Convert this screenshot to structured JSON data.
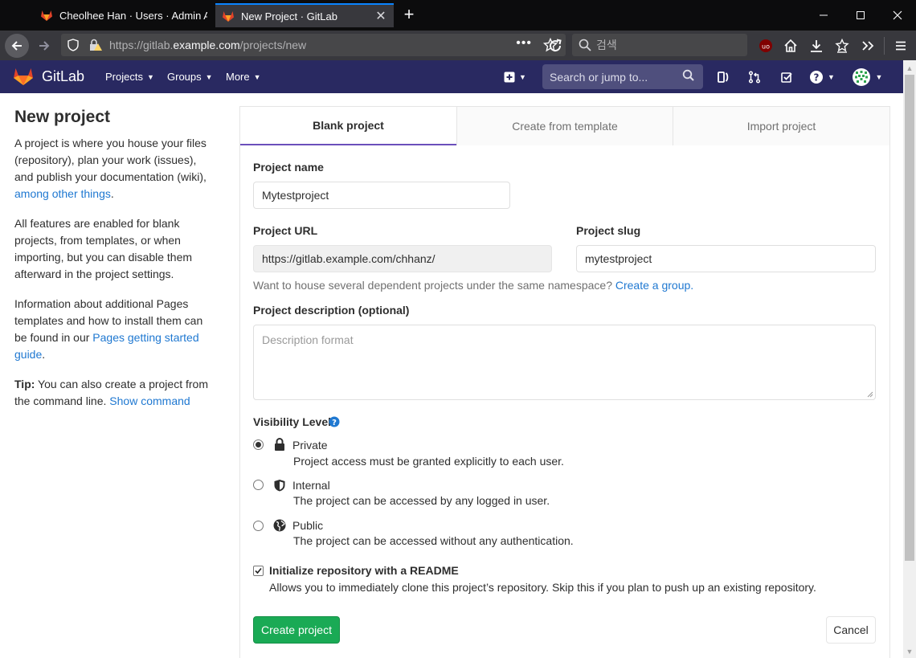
{
  "browser": {
    "tabs": [
      {
        "title": "Cheolhee Han · Users · Admin Area · GitLab",
        "active": false
      },
      {
        "title": "New Project · GitLab",
        "active": true
      }
    ],
    "url_prefix": "https://gitlab.",
    "url_domain": "example.com",
    "url_path": "/projects/new",
    "search_placeholder": "검색"
  },
  "gitlab_header": {
    "brand": "GitLab",
    "menu": [
      "Projects",
      "Groups",
      "More"
    ],
    "search_placeholder": "Search or jump to..."
  },
  "sidebar": {
    "title": "New project",
    "p1_text": "A project is where you house your files (repository), plan your work (issues), and publish your documentation (wiki), ",
    "p1_link": "among other things",
    "p1_end": ".",
    "p2_text": "All features are enabled for blank projects, from templates, or when importing, but you can disable them afterward in the project settings.",
    "p3_text": "Information about additional Pages templates and how to install them can be found in our ",
    "p3_link": "Pages getting started guide",
    "p3_end": ".",
    "tip_label": "Tip:",
    "tip_text": " You can also create a project from the command line. ",
    "tip_link": "Show command"
  },
  "panel_tabs": [
    "Blank project",
    "Create from template",
    "Import project"
  ],
  "form": {
    "project_name_label": "Project name",
    "project_name_value": "Mytestproject",
    "project_url_label": "Project URL",
    "project_url_value": "https://gitlab.example.com/chhanz/",
    "project_slug_label": "Project slug",
    "project_slug_value": "mytestproject",
    "namespace_help": "Want to house several dependent projects under the same namespace? ",
    "namespace_link": "Create a group.",
    "description_label": "Project description (optional)",
    "description_placeholder": "Description format",
    "visibility_label": "Visibility Level",
    "visibility_options": [
      {
        "title": "Private",
        "desc": "Project access must be granted explicitly to each user.",
        "checked": true,
        "icon": "lock-icon"
      },
      {
        "title": "Internal",
        "desc": "The project can be accessed by any logged in user.",
        "checked": false,
        "icon": "shield-icon"
      },
      {
        "title": "Public",
        "desc": "The project can be accessed without any authentication.",
        "checked": false,
        "icon": "globe-icon"
      }
    ],
    "readme_label": "Initialize repository with a README",
    "readme_checked": true,
    "readme_desc": "Allows you to immediately clone this project’s repository. Skip this if you plan to push up an existing repository.",
    "create_button": "Create project",
    "cancel_button": "Cancel"
  }
}
